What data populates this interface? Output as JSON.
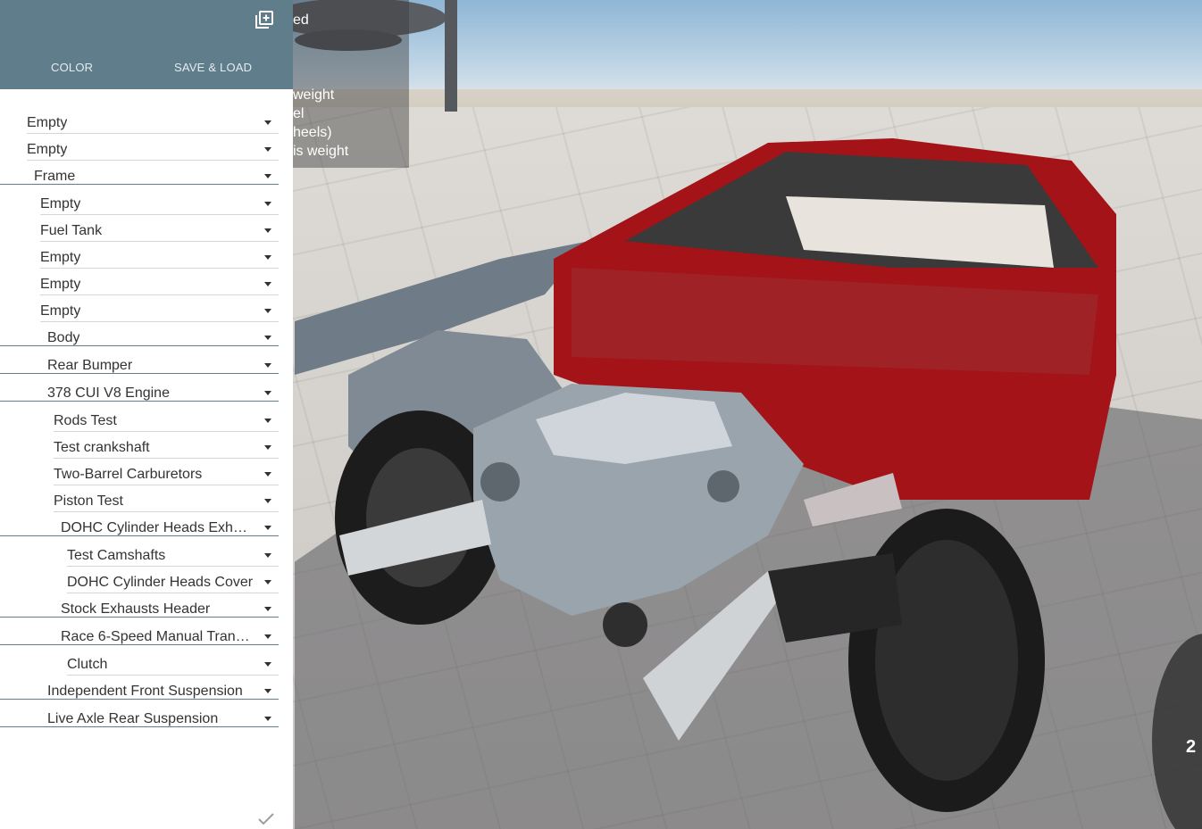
{
  "panel": {
    "tabs": [
      {
        "label": "COLOR"
      },
      {
        "label": "SAVE & LOAD"
      }
    ],
    "add_icon": "add-box-icon",
    "confirm_icon": "checkmark-icon",
    "header_color": "#607d8b",
    "parts": [
      {
        "label": "Empty"
      },
      {
        "label": "Empty"
      },
      {
        "label": "Frame"
      },
      {
        "label": "Empty"
      },
      {
        "label": "Fuel Tank"
      },
      {
        "label": "Empty"
      },
      {
        "label": "Empty"
      },
      {
        "label": "Empty"
      },
      {
        "label": "Body"
      },
      {
        "label": "Rear Bumper"
      },
      {
        "label": "378 CUI V8 Engine"
      },
      {
        "label": "Rods Test"
      },
      {
        "label": "Test crankshaft"
      },
      {
        "label": "Two-Barrel Carburetors"
      },
      {
        "label": "Piston Test"
      },
      {
        "label": "DOHC Cylinder Heads Exha..."
      },
      {
        "label": "Test Camshafts"
      },
      {
        "label": "DOHC Cylinder Heads Cover"
      },
      {
        "label": "Stock Exhausts Header"
      },
      {
        "label": "Race 6-Speed Manual Trans..."
      },
      {
        "label": "Clutch"
      },
      {
        "label": "Independent Front Suspension"
      },
      {
        "label": "Live Axle Rear Suspension"
      }
    ]
  },
  "viewport": {
    "info_lines": [
      "ed",
      "weight",
      "el",
      "heels)",
      "is weight"
    ],
    "gear": "2"
  }
}
